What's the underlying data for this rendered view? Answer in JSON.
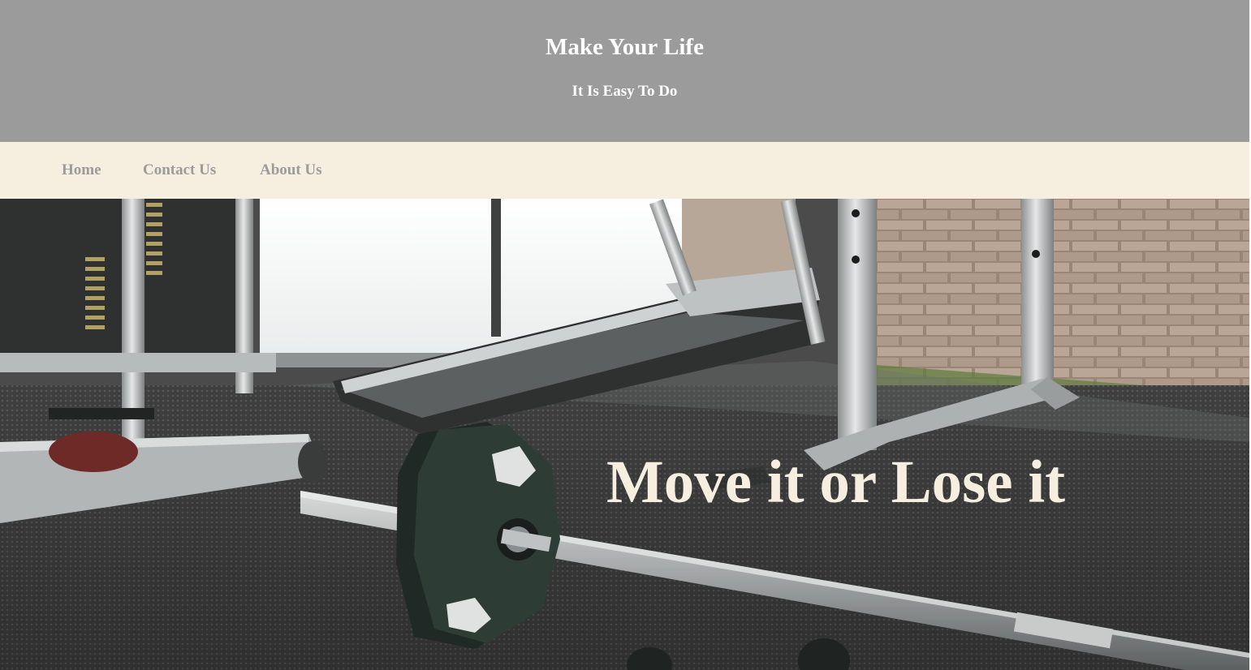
{
  "header": {
    "title": "Make Your Life",
    "subtitle": "It Is Easy To Do",
    "background_color": "#9b9b9b",
    "text_color": "#ffffff"
  },
  "nav": {
    "background_color": "#f6efe0",
    "link_color": "#9b9b9b",
    "items": [
      {
        "label": "Home"
      },
      {
        "label": "Contact Us"
      },
      {
        "label": "About Us"
      }
    ]
  },
  "hero": {
    "image_description_icon": "gym-photo",
    "headline": "Move it or Lose it",
    "headline_color": "#f6efe0"
  }
}
